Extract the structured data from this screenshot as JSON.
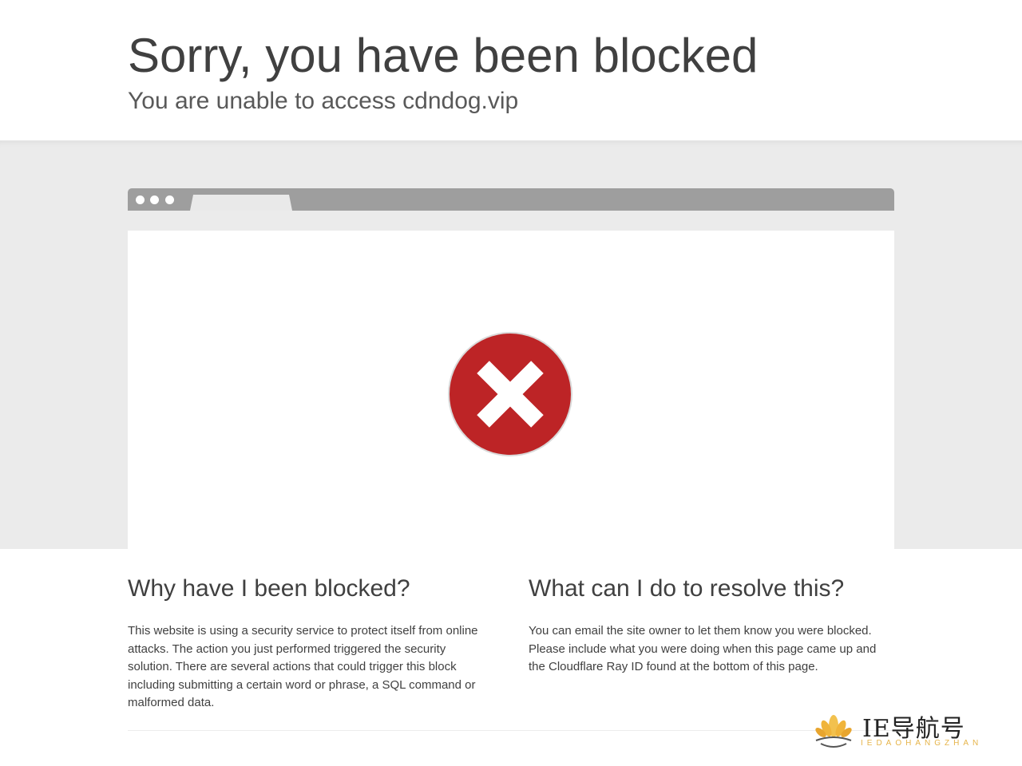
{
  "header": {
    "title": "Sorry, you have been blocked",
    "subtitle": "You are unable to access cdndog.vip"
  },
  "colors": {
    "error_red": "#bd2426",
    "band_grey": "#ebebeb",
    "browser_bar": "#9e9e9e",
    "watermark_gold": "#e6b44a"
  },
  "icons": {
    "error": "close-circle-icon"
  },
  "sections": [
    {
      "heading": "Why have I been blocked?",
      "body": "This website is using a security service to protect itself from online attacks. The action you just performed triggered the security solution. There are several actions that could trigger this block including submitting a certain word or phrase, a SQL command or malformed data."
    },
    {
      "heading": "What can I do to resolve this?",
      "body": "You can email the site owner to let them know you were blocked. Please include what you were doing when this page came up and the Cloudflare Ray ID found at the bottom of this page."
    }
  ],
  "watermark": {
    "text": "IE导航号",
    "subtext": "IEDAOHANGZHAN"
  }
}
